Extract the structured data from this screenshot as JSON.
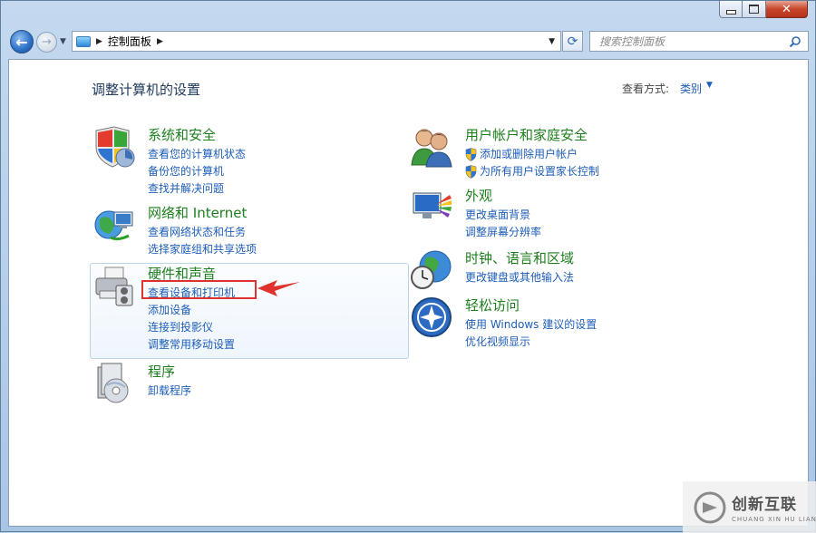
{
  "window": {
    "caption": {
      "minimize_icon": "minimize-icon",
      "maximize_icon": "maximize-icon",
      "close_label": "✕"
    }
  },
  "nav": {
    "back_icon": "back-arrow-icon",
    "forward_icon": "forward-arrow-icon",
    "address": {
      "segment": "控制面板"
    },
    "search": {
      "placeholder": "搜索控制面板"
    }
  },
  "header": {
    "title": "调整计算机的设置",
    "view_by_label": "查看方式:",
    "view_by_value": "类别"
  },
  "left_categories": [
    {
      "title": "系统和安全",
      "links": [
        "查看您的计算机状态",
        "备份您的计算机",
        "查找并解决问题"
      ]
    },
    {
      "title": "网络和 Internet",
      "links": [
        "查看网络状态和任务",
        "选择家庭组和共享选项"
      ]
    },
    {
      "title": "硬件和声音",
      "links": [
        "查看设备和打印机",
        "添加设备",
        "连接到投影仪",
        "调整常用移动设置"
      ]
    },
    {
      "title": "程序",
      "links": [
        "卸载程序"
      ]
    }
  ],
  "right_categories": [
    {
      "title": "用户帐户和家庭安全",
      "links": [
        "添加或删除用户帐户",
        "为所有用户设置家长控制"
      ]
    },
    {
      "title": "外观",
      "links": [
        "更改桌面背景",
        "调整屏幕分辨率"
      ]
    },
    {
      "title": "时钟、语言和区域",
      "links": [
        "更改键盘或其他输入法"
      ]
    },
    {
      "title": "轻松访问",
      "links": [
        "使用 Windows 建议的设置",
        "优化视频显示"
      ]
    }
  ],
  "watermark": {
    "name": "创新互联",
    "subtitle": "CHUANG XIN HU LIAN"
  },
  "colors": {
    "link": "#1e5eb8",
    "category_title": "#1e7f1e",
    "highlight": "#e0322c"
  }
}
